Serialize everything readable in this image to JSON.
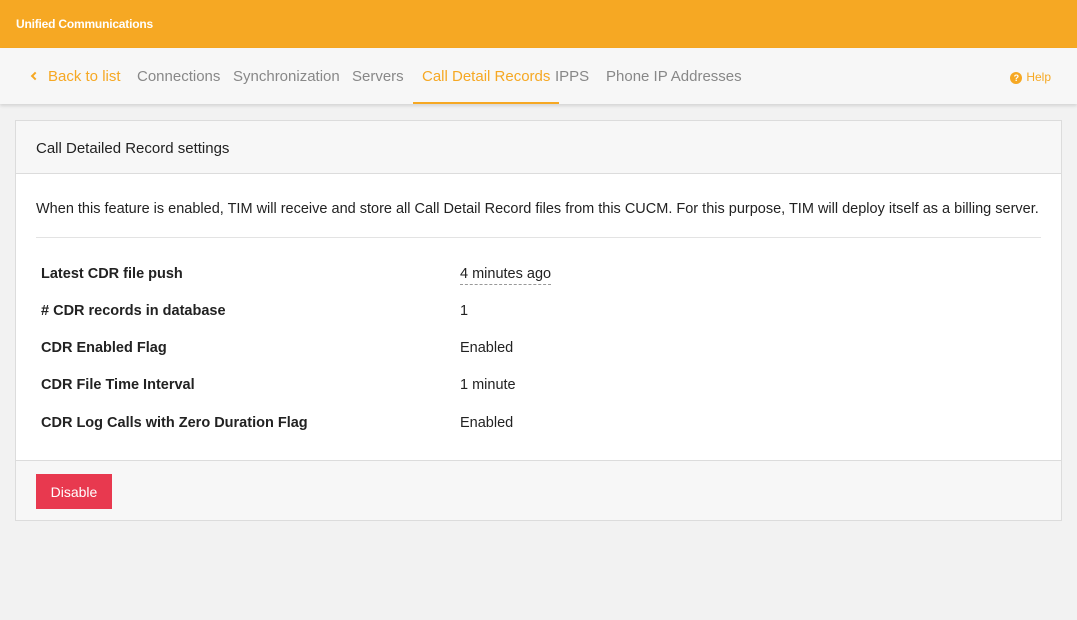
{
  "app": {
    "title": "Unified Communications"
  },
  "nav": {
    "back_label": "Back to list",
    "tabs": [
      {
        "label": "Connections"
      },
      {
        "label": "Synchronization"
      },
      {
        "label": "Servers"
      },
      {
        "label": "Call Detail Records"
      },
      {
        "label": "IPPS"
      },
      {
        "label": "Phone IP Addresses"
      }
    ],
    "active_tab": "Call Detail Records",
    "help_label": "Help",
    "help_icon_glyph": "?"
  },
  "panel": {
    "title": "Call Detailed Record settings",
    "description": "When this feature is enabled, TIM will receive and store all Call Detail Record files from this CUCM. For this purpose, TIM will deploy itself as a billing server.",
    "rows": [
      {
        "label": "Latest CDR file push",
        "value": "4 minutes ago"
      },
      {
        "label": "# CDR records in database",
        "value": "1"
      },
      {
        "label": "CDR Enabled Flag",
        "value": "Enabled"
      },
      {
        "label": "CDR File Time Interval",
        "value": "1 minute"
      },
      {
        "label": "CDR Log Calls with Zero Duration Flag",
        "value": "Enabled"
      }
    ],
    "disable_label": "Disable"
  },
  "colors": {
    "brand": "#f6a823",
    "danger": "#e8394f",
    "background": "#f2f2f2"
  }
}
